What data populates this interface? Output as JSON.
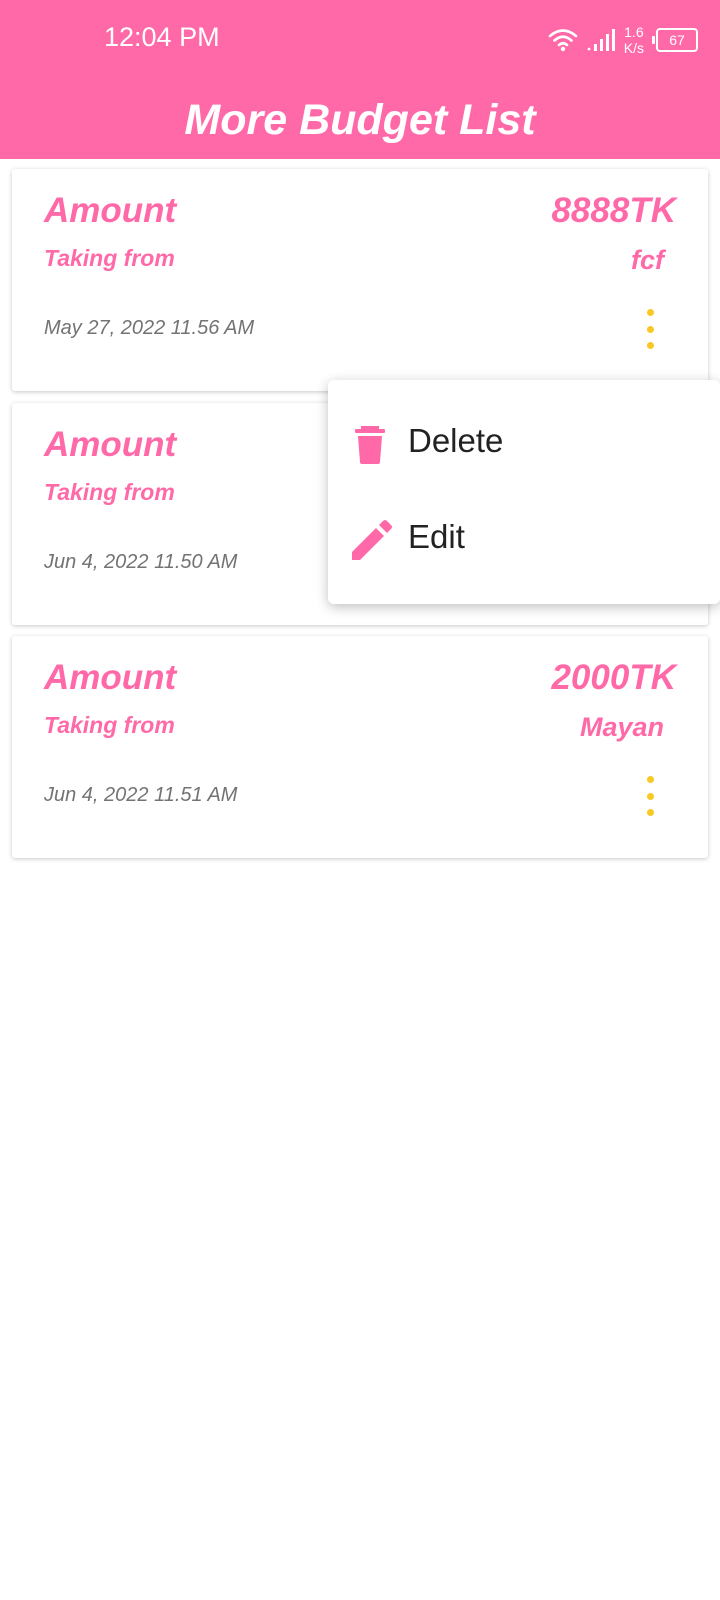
{
  "status_bar": {
    "time": "12:04 PM",
    "net_speed_value": "1.6",
    "net_speed_unit": "K/s",
    "battery": "67",
    "icons": [
      "wifi-icon",
      "signal-icon",
      "battery-icon"
    ]
  },
  "header": {
    "title": "More Budget List"
  },
  "colors": {
    "primary": "#ff69a8",
    "accent_dots": "#f9c825",
    "date_text": "#737373"
  },
  "budgets": [
    {
      "label": "Amount",
      "value": "8888TK",
      "sublabel": "Taking from",
      "source": "fcf",
      "date": "May 27, 2022 11.56 AM"
    },
    {
      "label": "Amount",
      "value": "",
      "sublabel": "Taking from",
      "source": "",
      "date": "Jun 4, 2022 11.50 AM"
    },
    {
      "label": "Amount",
      "value": "2000TK",
      "sublabel": "Taking from",
      "source": "Mayan",
      "date": "Jun 4, 2022 11.51 AM"
    }
  ],
  "context_menu": {
    "items": [
      {
        "label": "Delete",
        "icon": "delete-icon"
      },
      {
        "label": "Edit",
        "icon": "edit-icon"
      }
    ]
  }
}
